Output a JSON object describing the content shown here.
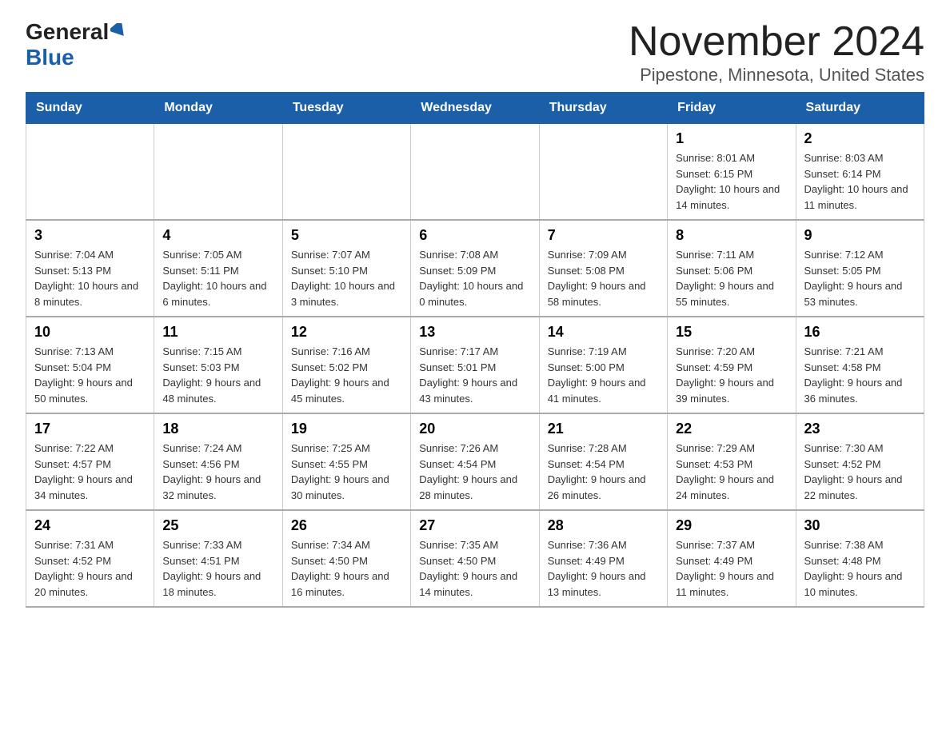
{
  "logo": {
    "general": "General",
    "blue": "Blue"
  },
  "title": "November 2024",
  "subtitle": "Pipestone, Minnesota, United States",
  "weekdays": [
    "Sunday",
    "Monday",
    "Tuesday",
    "Wednesday",
    "Thursday",
    "Friday",
    "Saturday"
  ],
  "weeks": [
    [
      {
        "day": "",
        "info": ""
      },
      {
        "day": "",
        "info": ""
      },
      {
        "day": "",
        "info": ""
      },
      {
        "day": "",
        "info": ""
      },
      {
        "day": "",
        "info": ""
      },
      {
        "day": "1",
        "info": "Sunrise: 8:01 AM\nSunset: 6:15 PM\nDaylight: 10 hours\nand 14 minutes."
      },
      {
        "day": "2",
        "info": "Sunrise: 8:03 AM\nSunset: 6:14 PM\nDaylight: 10 hours\nand 11 minutes."
      }
    ],
    [
      {
        "day": "3",
        "info": "Sunrise: 7:04 AM\nSunset: 5:13 PM\nDaylight: 10 hours\nand 8 minutes."
      },
      {
        "day": "4",
        "info": "Sunrise: 7:05 AM\nSunset: 5:11 PM\nDaylight: 10 hours\nand 6 minutes."
      },
      {
        "day": "5",
        "info": "Sunrise: 7:07 AM\nSunset: 5:10 PM\nDaylight: 10 hours\nand 3 minutes."
      },
      {
        "day": "6",
        "info": "Sunrise: 7:08 AM\nSunset: 5:09 PM\nDaylight: 10 hours\nand 0 minutes."
      },
      {
        "day": "7",
        "info": "Sunrise: 7:09 AM\nSunset: 5:08 PM\nDaylight: 9 hours\nand 58 minutes."
      },
      {
        "day": "8",
        "info": "Sunrise: 7:11 AM\nSunset: 5:06 PM\nDaylight: 9 hours\nand 55 minutes."
      },
      {
        "day": "9",
        "info": "Sunrise: 7:12 AM\nSunset: 5:05 PM\nDaylight: 9 hours\nand 53 minutes."
      }
    ],
    [
      {
        "day": "10",
        "info": "Sunrise: 7:13 AM\nSunset: 5:04 PM\nDaylight: 9 hours\nand 50 minutes."
      },
      {
        "day": "11",
        "info": "Sunrise: 7:15 AM\nSunset: 5:03 PM\nDaylight: 9 hours\nand 48 minutes."
      },
      {
        "day": "12",
        "info": "Sunrise: 7:16 AM\nSunset: 5:02 PM\nDaylight: 9 hours\nand 45 minutes."
      },
      {
        "day": "13",
        "info": "Sunrise: 7:17 AM\nSunset: 5:01 PM\nDaylight: 9 hours\nand 43 minutes."
      },
      {
        "day": "14",
        "info": "Sunrise: 7:19 AM\nSunset: 5:00 PM\nDaylight: 9 hours\nand 41 minutes."
      },
      {
        "day": "15",
        "info": "Sunrise: 7:20 AM\nSunset: 4:59 PM\nDaylight: 9 hours\nand 39 minutes."
      },
      {
        "day": "16",
        "info": "Sunrise: 7:21 AM\nSunset: 4:58 PM\nDaylight: 9 hours\nand 36 minutes."
      }
    ],
    [
      {
        "day": "17",
        "info": "Sunrise: 7:22 AM\nSunset: 4:57 PM\nDaylight: 9 hours\nand 34 minutes."
      },
      {
        "day": "18",
        "info": "Sunrise: 7:24 AM\nSunset: 4:56 PM\nDaylight: 9 hours\nand 32 minutes."
      },
      {
        "day": "19",
        "info": "Sunrise: 7:25 AM\nSunset: 4:55 PM\nDaylight: 9 hours\nand 30 minutes."
      },
      {
        "day": "20",
        "info": "Sunrise: 7:26 AM\nSunset: 4:54 PM\nDaylight: 9 hours\nand 28 minutes."
      },
      {
        "day": "21",
        "info": "Sunrise: 7:28 AM\nSunset: 4:54 PM\nDaylight: 9 hours\nand 26 minutes."
      },
      {
        "day": "22",
        "info": "Sunrise: 7:29 AM\nSunset: 4:53 PM\nDaylight: 9 hours\nand 24 minutes."
      },
      {
        "day": "23",
        "info": "Sunrise: 7:30 AM\nSunset: 4:52 PM\nDaylight: 9 hours\nand 22 minutes."
      }
    ],
    [
      {
        "day": "24",
        "info": "Sunrise: 7:31 AM\nSunset: 4:52 PM\nDaylight: 9 hours\nand 20 minutes."
      },
      {
        "day": "25",
        "info": "Sunrise: 7:33 AM\nSunset: 4:51 PM\nDaylight: 9 hours\nand 18 minutes."
      },
      {
        "day": "26",
        "info": "Sunrise: 7:34 AM\nSunset: 4:50 PM\nDaylight: 9 hours\nand 16 minutes."
      },
      {
        "day": "27",
        "info": "Sunrise: 7:35 AM\nSunset: 4:50 PM\nDaylight: 9 hours\nand 14 minutes."
      },
      {
        "day": "28",
        "info": "Sunrise: 7:36 AM\nSunset: 4:49 PM\nDaylight: 9 hours\nand 13 minutes."
      },
      {
        "day": "29",
        "info": "Sunrise: 7:37 AM\nSunset: 4:49 PM\nDaylight: 9 hours\nand 11 minutes."
      },
      {
        "day": "30",
        "info": "Sunrise: 7:38 AM\nSunset: 4:48 PM\nDaylight: 9 hours\nand 10 minutes."
      }
    ]
  ],
  "colors": {
    "header_bg": "#1a5fa8",
    "header_text": "#ffffff",
    "border": "#cccccc"
  }
}
